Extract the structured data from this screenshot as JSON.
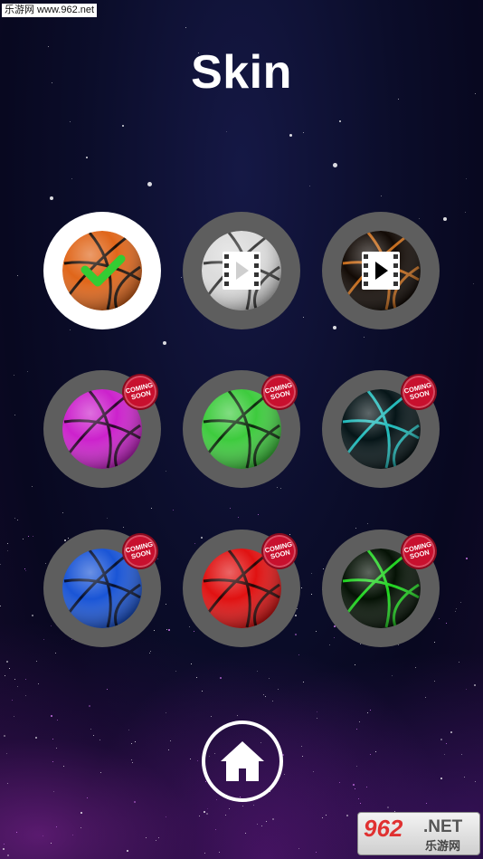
{
  "watermark_top": "乐游网 www.962.net",
  "title": "Skin",
  "coming_soon_line1": "COMING",
  "coming_soon_line2": "SOON",
  "skins": [
    {
      "name": "orange",
      "state": "selected",
      "color": "#e0661a",
      "line": "#1a0d05"
    },
    {
      "name": "white",
      "state": "video",
      "color": "#dcdcdc",
      "line": "#3a3a3a"
    },
    {
      "name": "dark-orange",
      "state": "video",
      "color": "#120a05",
      "line": "#c46a1a"
    },
    {
      "name": "magenta",
      "state": "coming-soon",
      "color": "#cc22cc",
      "line": "#2a052a"
    },
    {
      "name": "green",
      "state": "coming-soon",
      "color": "#3ecb3e",
      "line": "#0b2a0b"
    },
    {
      "name": "dark-cyan",
      "state": "coming-soon",
      "color": "#061518",
      "line": "#1fb8b8"
    },
    {
      "name": "blue",
      "state": "coming-soon",
      "color": "#1a55d6",
      "line": "#051030"
    },
    {
      "name": "red",
      "state": "coming-soon",
      "color": "#e01212",
      "line": "#2a0404"
    },
    {
      "name": "dark-green",
      "state": "coming-soon",
      "color": "#051205",
      "line": "#1ed21e"
    }
  ],
  "watermark_bottom": {
    "num": "962",
    "net": ".NET",
    "cn": "乐游网"
  },
  "colors": {
    "check": "#33cc33",
    "badge": "#c8102e",
    "slot": "#5e5e5e"
  }
}
